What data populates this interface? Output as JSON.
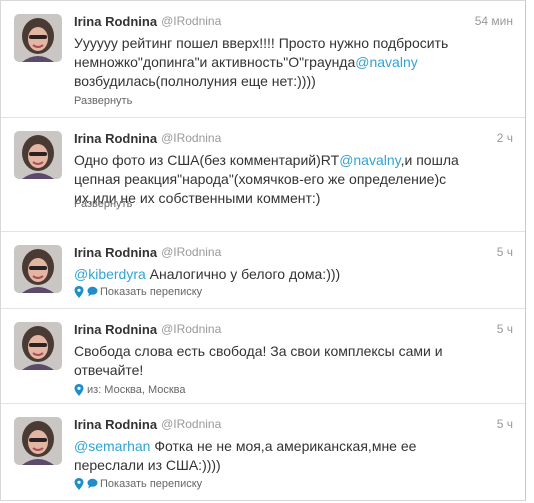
{
  "tweets": [
    {
      "name": "Irina Rodnina",
      "handle": "@IRodnina",
      "time": "54 мин",
      "text_parts": [
        {
          "text": "Уууууу рейтинг пошел вверх!!!! Просто нужно подбросить немножко\"допинга\"и активность\"О\"граунда",
          "mention": false
        },
        {
          "text": "@navalny",
          "mention": true
        },
        {
          "text": " возбудилась(полнолуния еще нет:))))",
          "mention": false
        }
      ],
      "action": "Развернуть"
    },
    {
      "name": "Irina Rodnina",
      "handle": "@IRodnina",
      "time": "2 ч",
      "text_parts": [
        {
          "text": "Одно фото из США(без комментарий)RT",
          "mention": false
        },
        {
          "text": "@navalny",
          "mention": true
        },
        {
          "text": ",и пошла цепная реакция\"народа\"(хомячков-его же определение)с их,или не их собственными коммент:)",
          "mention": false
        }
      ],
      "action": "Развернуть"
    },
    {
      "name": "Irina Rodnina",
      "handle": "@IRodnina",
      "time": "5 ч",
      "text_parts": [
        {
          "text": "@kiberdyra",
          "mention": true
        },
        {
          "text": " Аналогично у белого дома:)))",
          "mention": false
        }
      ],
      "action": "Показать переписку"
    },
    {
      "name": "Irina Rodnina",
      "handle": "@IRodnina",
      "time": "5 ч",
      "text_parts": [
        {
          "text": "Свобода слова есть свобода! За свои комплексы сами и отвечайте!",
          "mention": false
        }
      ],
      "action": "из: Москва, Москва"
    },
    {
      "name": "Irina Rodnina",
      "handle": "@IRodnina",
      "time": "5 ч",
      "text_parts": [
        {
          "text": "@semarhan",
          "mention": true
        },
        {
          "text": " Фотка не не моя,а американская,мне ее переслали из США:))))",
          "mention": false
        }
      ],
      "action": "Показать переписку"
    }
  ],
  "icons": {
    "location": "map-pin-icon",
    "conversation": "speech-bubble-icon"
  },
  "colors": {
    "mention": "#2fa3d6",
    "action_icon": "#1d8dcc"
  }
}
